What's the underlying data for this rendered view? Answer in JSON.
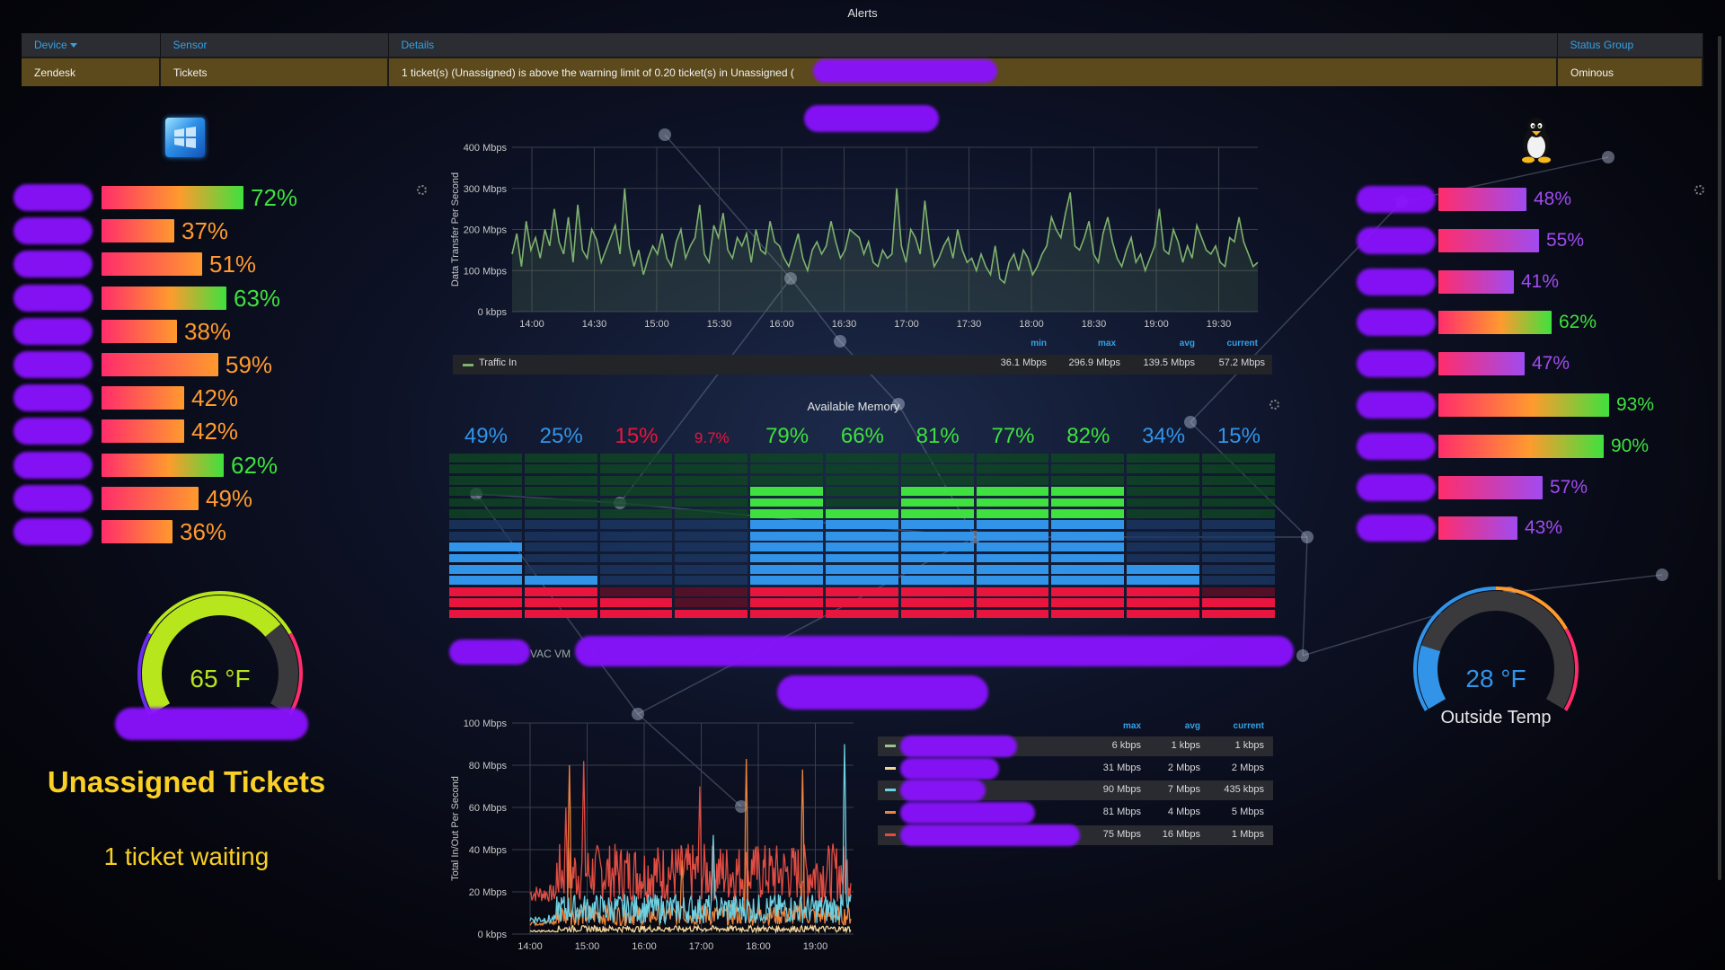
{
  "alerts": {
    "title": "Alerts",
    "headers": {
      "device": "Device",
      "sensor": "Sensor",
      "details": "Details",
      "status_group": "Status Group"
    },
    "row": {
      "device": "Zendesk",
      "sensor": "Tickets",
      "details": "1 ticket(s) (Unassigned) is above the warning limit of 0.20 ticket(s) in Unassigned (",
      "status_group": "Ominous"
    }
  },
  "left_panel": {
    "logo": "windows-logo-icon",
    "bars": [
      {
        "label": "72%",
        "value": 72,
        "color": "#3ee13e"
      },
      {
        "label": "37%",
        "value": 37,
        "color": "#ff9a2e"
      },
      {
        "label": "51%",
        "value": 51,
        "color": "#ff9a2e"
      },
      {
        "label": "63%",
        "value": 63,
        "color": "#3ee13e"
      },
      {
        "label": "38%",
        "value": 38,
        "color": "#ff9a2e"
      },
      {
        "label": "59%",
        "value": 59,
        "color": "#ff9a2e"
      },
      {
        "label": "42%",
        "value": 42,
        "color": "#ff9a2e"
      },
      {
        "label": "42%",
        "value": 42,
        "color": "#ff9a2e"
      },
      {
        "label": "62%",
        "value": 62,
        "color": "#3ee13e"
      },
      {
        "label": "49%",
        "value": 49,
        "color": "#ff9a2e"
      },
      {
        "label": "36%",
        "value": 36,
        "color": "#ff9a2e"
      }
    ],
    "gauge": {
      "value": "65 °F",
      "fill": 0.71,
      "color": "#b7e61c"
    },
    "tickets_title": "Unassigned Tickets",
    "tickets_sub": "1 ticket waiting"
  },
  "right_panel": {
    "logo": "linux-penguin-icon",
    "bars": [
      {
        "label": "48%",
        "value": 48,
        "color": "#a04bf0"
      },
      {
        "label": "55%",
        "value": 55,
        "color": "#a04bf0"
      },
      {
        "label": "41%",
        "value": 41,
        "color": "#a04bf0"
      },
      {
        "label": "62%",
        "value": 62,
        "color": "#3ee13e"
      },
      {
        "label": "47%",
        "value": 47,
        "color": "#a04bf0"
      },
      {
        "label": "93%",
        "value": 93,
        "color": "#3ee13e"
      },
      {
        "label": "90%",
        "value": 90,
        "color": "#3ee13e"
      },
      {
        "label": "57%",
        "value": 57,
        "color": "#a04bf0"
      },
      {
        "label": "43%",
        "value": 43,
        "color": "#a04bf0"
      }
    ],
    "gauge": {
      "value": "28 °F",
      "caption": "Outside Temp",
      "fill": 0.2,
      "color": "#3294e9"
    }
  },
  "memory": {
    "title": "Available Memory",
    "columns": [
      {
        "label": "49%",
        "value": 49,
        "color": "#3294e9"
      },
      {
        "label": "25%",
        "value": 25,
        "color": "#3294e9"
      },
      {
        "label": "15%",
        "value": 15,
        "color": "#e8163f"
      },
      {
        "label": "9.7%",
        "value": 9.7,
        "color": "#e8163f"
      },
      {
        "label": "79%",
        "value": 79,
        "color": "#3ee13e"
      },
      {
        "label": "66%",
        "value": 66,
        "color": "#3ee13e"
      },
      {
        "label": "81%",
        "value": 81,
        "color": "#3ee13e"
      },
      {
        "label": "77%",
        "value": 77,
        "color": "#3ee13e"
      },
      {
        "label": "82%",
        "value": 82,
        "color": "#3ee13e"
      },
      {
        "label": "34%",
        "value": 34,
        "color": "#3294e9"
      },
      {
        "label": "15%",
        "value": 15,
        "color": "#3294e9"
      }
    ],
    "footer_text": "VAC VM"
  },
  "chart_data": [
    {
      "type": "line",
      "ylabel": "Data Transfer Per Second",
      "yticks": [
        "0 kbps",
        "100 Mbps",
        "200 Mbps",
        "300 Mbps",
        "400 Mbps"
      ],
      "ylim": [
        0,
        400
      ],
      "xticks": [
        "14:00",
        "14:30",
        "15:00",
        "15:30",
        "16:00",
        "16:30",
        "17:00",
        "17:30",
        "18:00",
        "18:30",
        "19:00",
        "19:30"
      ],
      "x_start_min": 820,
      "x_end_min": 1185,
      "series": [
        {
          "name": "Traffic In",
          "color": "#7eb26d",
          "values": [
            140,
            190,
            110,
            220,
            150,
            180,
            130,
            200,
            160,
            250,
            170,
            140,
            230,
            120,
            260,
            150,
            130,
            200,
            175,
            120,
            150,
            180,
            210,
            140,
            300,
            160,
            110,
            150,
            90,
            130,
            160,
            140,
            190,
            130,
            110,
            170,
            200,
            130,
            160,
            180,
            260,
            140,
            120,
            210,
            180,
            240,
            150,
            130,
            180,
            160,
            190,
            120,
            200,
            150,
            140,
            220,
            170,
            160,
            130,
            110,
            150,
            190,
            130,
            100,
            150,
            170,
            140,
            160,
            220,
            170,
            130,
            150,
            200,
            190,
            180,
            140,
            170,
            120,
            110,
            150,
            130,
            140,
            300,
            160,
            120,
            200,
            180,
            140,
            270,
            170,
            110,
            130,
            160,
            180,
            130,
            200,
            150,
            120,
            130,
            100,
            140,
            110,
            90,
            160,
            80,
            70,
            120,
            140,
            100,
            150,
            130,
            90,
            110,
            140,
            160,
            230,
            200,
            180,
            240,
            290,
            160,
            150,
            180,
            220,
            140,
            120,
            190,
            230,
            170,
            130,
            110,
            150,
            180,
            120,
            140,
            100,
            130,
            160,
            250,
            150,
            140,
            200,
            170,
            120,
            160,
            130,
            210,
            180,
            150,
            140,
            160,
            120,
            110,
            180,
            170,
            230,
            170,
            140,
            110,
            120
          ]
        }
      ],
      "legend_headers": [
        "min",
        "max",
        "avg",
        "current"
      ],
      "legend_values": [
        "36.1 Mbps",
        "296.9 Mbps",
        "139.5 Mbps",
        "57.2 Mbps"
      ]
    },
    {
      "type": "line",
      "ylabel": "Total In/Out Per Second",
      "yticks": [
        "0 kbps",
        "20 Mbps",
        "40 Mbps",
        "60 Mbps",
        "80 Mbps",
        "100 Mbps"
      ],
      "ylim": [
        0,
        100
      ],
      "xticks": [
        "14:00",
        "15:00",
        "16:00",
        "17:00",
        "18:00",
        "19:00"
      ],
      "legend_headers": [
        "max",
        "avg",
        "current"
      ],
      "legend_rows": [
        {
          "color": "#9ac48a",
          "max": "6 kbps",
          "avg": "1 kbps",
          "current": "1 kbps"
        },
        {
          "color": "#f4d598",
          "max": "31 Mbps",
          "avg": "2 Mbps",
          "current": "2 Mbps"
        },
        {
          "color": "#6ed0e0",
          "max": "90 Mbps",
          "avg": "7 Mbps",
          "current": "435 kbps"
        },
        {
          "color": "#ef843c",
          "max": "81 Mbps",
          "avg": "4 Mbps",
          "current": "5 Mbps"
        },
        {
          "color": "#e24d42",
          "max": "75 Mbps",
          "avg": "16 Mbps",
          "current": "1 Mbps"
        }
      ]
    }
  ]
}
